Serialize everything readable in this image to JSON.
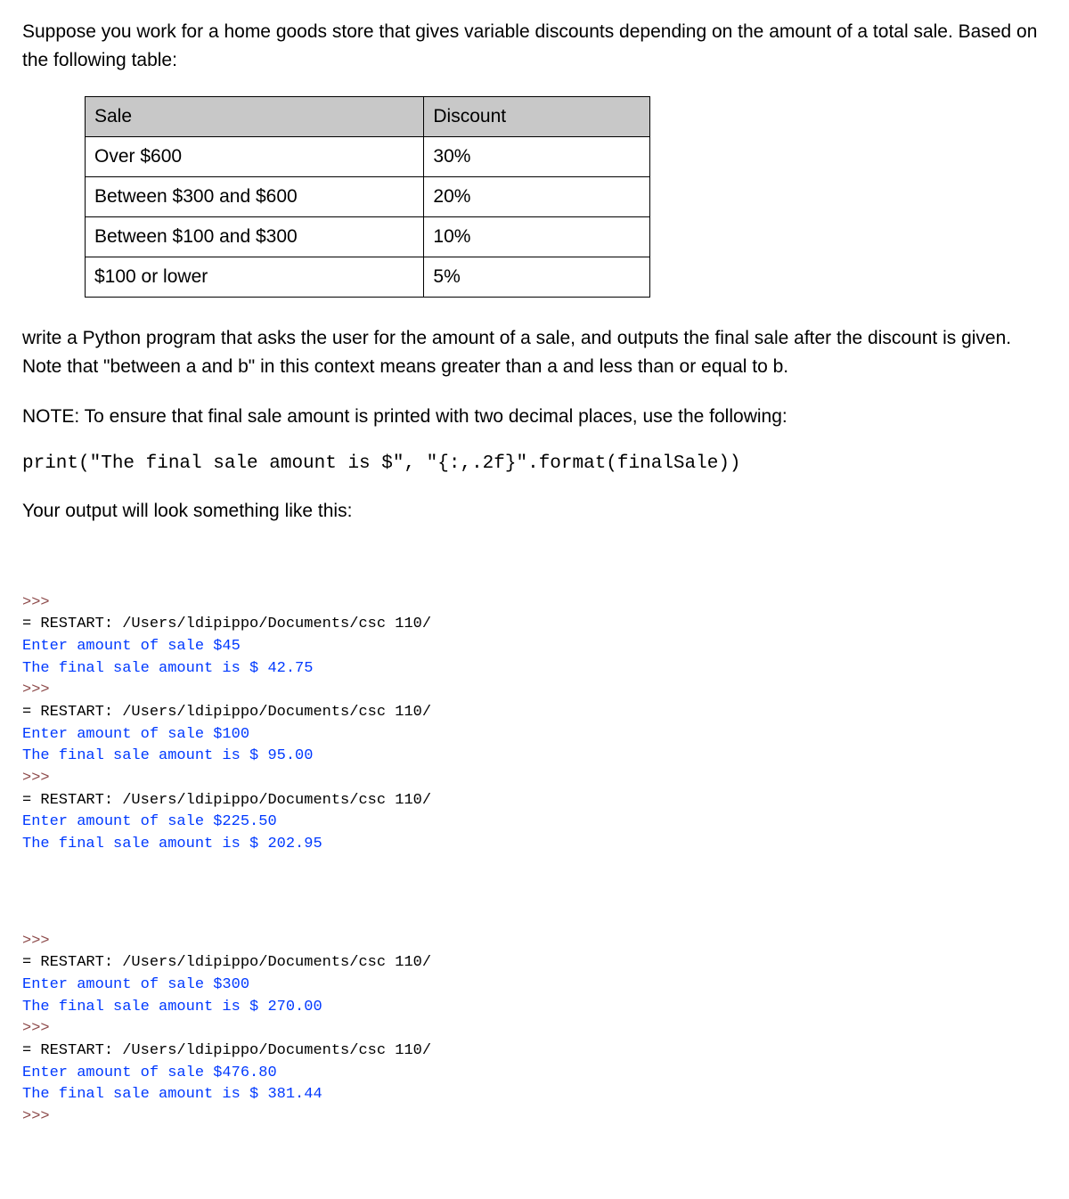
{
  "intro": "Suppose you work for a home goods store that gives variable discounts depending on the amount of a total sale.  Based on the following table:",
  "table": {
    "headers": [
      "Sale",
      "Discount"
    ],
    "rows": [
      [
        "Over $600",
        "30%"
      ],
      [
        "Between $300 and $600",
        "20%"
      ],
      [
        "Between $100 and $300",
        "10%"
      ],
      [
        "$100 or lower",
        "5%"
      ]
    ]
  },
  "body": "write a Python program that asks the user for the amount of a sale, and outputs the final sale after the discount is given.  Note that \"between a and b\" in this context means greater than a and less than or equal to b.",
  "note": "NOTE:  To ensure that final sale amount is printed with two decimal places, use the following:",
  "code": "print(\"The final sale amount is $\", \"{:,.2f}\".format(finalSale))",
  "outputLabel": "Your output will look something like this:",
  "console": {
    "block1": [
      {
        "type": "prompt",
        "text": ">>>"
      },
      {
        "type": "restart",
        "text": "= RESTART: /Users/ldipippo/Documents/csc 110/"
      },
      {
        "type": "io",
        "text": "Enter amount of sale $45"
      },
      {
        "type": "io",
        "text": "The final sale amount is $ 42.75"
      },
      {
        "type": "prompt",
        "text": ">>>"
      },
      {
        "type": "restart",
        "text": "= RESTART: /Users/ldipippo/Documents/csc 110/"
      },
      {
        "type": "io",
        "text": "Enter amount of sale $100"
      },
      {
        "type": "io",
        "text": "The final sale amount is $ 95.00"
      },
      {
        "type": "prompt",
        "text": ">>>"
      },
      {
        "type": "restart",
        "text": "= RESTART: /Users/ldipippo/Documents/csc 110/"
      },
      {
        "type": "io",
        "text": "Enter amount of sale $225.50"
      },
      {
        "type": "io",
        "text": "The final sale amount is $ 202.95"
      }
    ],
    "block2": [
      {
        "type": "prompt",
        "text": ">>>"
      },
      {
        "type": "restart",
        "text": "= RESTART: /Users/ldipippo/Documents/csc 110/"
      },
      {
        "type": "io",
        "text": "Enter amount of sale $300"
      },
      {
        "type": "io",
        "text": "The final sale amount is $ 270.00"
      },
      {
        "type": "prompt",
        "text": ">>>"
      },
      {
        "type": "restart",
        "text": "= RESTART: /Users/ldipippo/Documents/csc 110/"
      },
      {
        "type": "io",
        "text": "Enter amount of sale $476.80"
      },
      {
        "type": "io",
        "text": "The final sale amount is $ 381.44"
      },
      {
        "type": "prompt",
        "text": ">>>"
      }
    ]
  }
}
